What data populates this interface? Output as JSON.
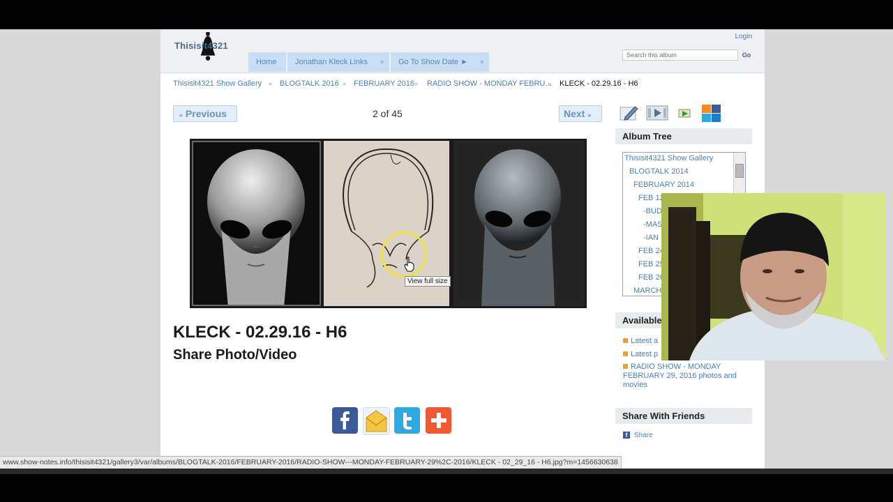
{
  "header": {
    "logo_text": "Thisisit4321",
    "login": "Login",
    "search_placeholder": "Search this album",
    "search_go": "Go",
    "nav": [
      "Home",
      "Jonathan Kleck Links",
      "Go To Show Date ►"
    ]
  },
  "breadcrumb": {
    "items": [
      "Thisisit4321 Show Gallery",
      "BLOGTALK 2016",
      "FEBRUARY 2016",
      "RADIO SHOW - MONDAY FEBRU...",
      "KLECK - 02.29.16 - H6"
    ],
    "separator": "»"
  },
  "pager": {
    "previous": "Previous",
    "next": "Next",
    "position": "2 of 45"
  },
  "photo": {
    "tooltip": "View full size"
  },
  "item": {
    "title": "KLECK - 02.29.16 - H6",
    "share_heading": "Share Photo/Video"
  },
  "sidebar": {
    "album_tree_title": "Album Tree",
    "tree": [
      "Thisisit4321 Show Gallery",
      "BLOGTALK 2014",
      "FEBRUARY 2014",
      "FEB 12",
      "-BUD",
      "-MAS",
      "-IAN",
      "FEB 24",
      "FEB 25",
      "FEB 26",
      "MARCH"
    ],
    "available_title": "Available",
    "available_items": [
      "Latest a",
      "Latest p",
      "RADIO SHOW - MONDAY FEBRUARY 29, 2016 photos and movies"
    ],
    "share_friends_title": "Share With Friends",
    "share_link": "Share"
  },
  "status_bar": {
    "url": "www.show-notes.info/thisisit4321/gallery3/var/albums/BLOGTALK-2016/FEBRUARY-2016/RADIO-SHOW---MONDAY-FEBRUARY-29%2C-2016/KLECK - 02_29_16 - H6.jpg?m=1456630638"
  },
  "colors": {
    "link": "#4a7fb5",
    "nav_bg": "#c9def4",
    "facebook": "#3b5998",
    "twitter": "#2fa8df",
    "addthis": "#f05a32"
  }
}
